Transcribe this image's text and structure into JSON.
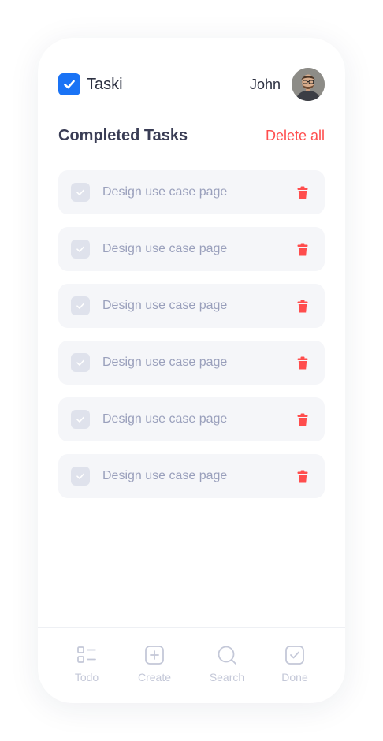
{
  "app": {
    "name": "Taski",
    "logo_icon": "checkbox-icon"
  },
  "user": {
    "name": "John"
  },
  "section": {
    "title": "Completed Tasks",
    "delete_all_label": "Delete all"
  },
  "tasks": [
    {
      "label": "Design use case page",
      "completed": true
    },
    {
      "label": "Design use case page",
      "completed": true
    },
    {
      "label": "Design use case page",
      "completed": true
    },
    {
      "label": "Design use case page",
      "completed": true
    },
    {
      "label": "Design use case page",
      "completed": true
    },
    {
      "label": "Design use case page",
      "completed": true
    }
  ],
  "tabbar": {
    "items": [
      {
        "label": "Todo",
        "icon": "list-icon"
      },
      {
        "label": "Create",
        "icon": "plus-square-icon"
      },
      {
        "label": "Search",
        "icon": "search-icon"
      },
      {
        "label": "Done",
        "icon": "check-square-icon"
      }
    ]
  },
  "colors": {
    "accent": "#1a73f5",
    "danger": "#ff4d4d",
    "text": "#2d3142",
    "muted": "#9aa0bc",
    "tab_inactive": "#c4c8d8"
  }
}
